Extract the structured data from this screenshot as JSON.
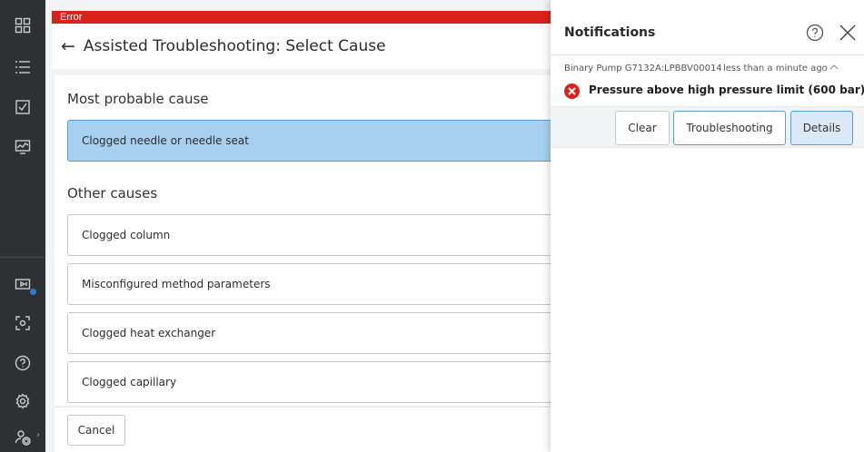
{
  "error_bar": {
    "label": "Error"
  },
  "header": {
    "back_icon": "arrow-left-icon",
    "title": "Assisted Troubleshooting: Select Cause"
  },
  "sidebar": {
    "top_icons": [
      "grid-icon",
      "list-icon",
      "checkbox-icon",
      "monitor-chart-icon"
    ],
    "bottom_icons": [
      "media-icon",
      "focus-icon",
      "help-icon",
      "settings-icon",
      "user-settings-icon"
    ]
  },
  "most_probable": {
    "title": "Most probable cause",
    "cause": "Clogged needle or needle seat"
  },
  "other": {
    "title": "Other causes",
    "causes": [
      "Clogged column",
      "Misconfigured method parameters",
      "Clogged heat exchanger",
      "Clogged capillary"
    ]
  },
  "footer": {
    "cancel_label": "Cancel"
  },
  "notifications": {
    "title": "Notifications",
    "item": {
      "source": "Binary Pump G7132A:LPBBV00014",
      "time": "less than a minute ago",
      "message": "Pressure above high pressure limit (600 bar)"
    },
    "actions": {
      "clear": "Clear",
      "troubleshooting": "Troubleshooting",
      "details": "Details"
    }
  },
  "colors": {
    "error": "#d9221b",
    "selected": "#a6cff0",
    "accent": "#5a9fd6",
    "sidebar": "#2e3033"
  }
}
